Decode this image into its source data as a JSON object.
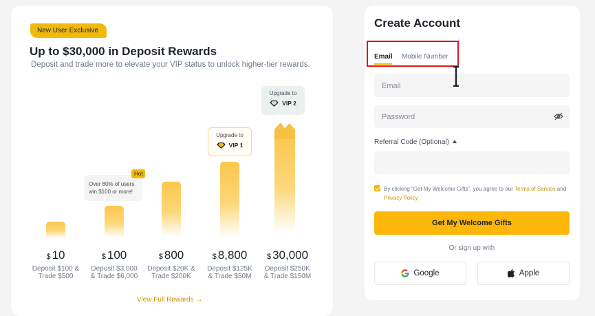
{
  "rewards": {
    "badge": "New User Exclusive",
    "title": "Up to $30,000 in Deposit Rewards",
    "subtitle": "Deposit and trade more to elevate your VIP status to unlock higher-tier rewards.",
    "hot_badge": "Hot",
    "hot_tip_line1": "Over 80% of users",
    "hot_tip_line2": "win $100 or more!",
    "vip1_upgrade": "Upgrade to",
    "vip1_label": "VIP 1",
    "vip2_upgrade": "Upgrade to",
    "vip2_label": "VIP 2",
    "currency": "$",
    "tiers": [
      {
        "amount": "10",
        "line1": "Deposit $100 &",
        "line2": "Trade $500",
        "level": 0.1
      },
      {
        "amount": "100",
        "line1": "Deposit $3,000",
        "line2": "& Trade $6,000",
        "level": 0.22
      },
      {
        "amount": "800",
        "line1": "Deposit $20K &",
        "line2": "Trade $200K",
        "level": 0.42
      },
      {
        "amount": "8,800",
        "line1": "Deposit $125K",
        "line2": "& Trade $50M",
        "level": 0.6
      },
      {
        "amount": "30,000",
        "line1": "Deposit $250K",
        "line2": "& Trade $150M",
        "level": 1.0
      }
    ],
    "view_link": "View Full Rewards →"
  },
  "form": {
    "title": "Create Account",
    "tabs": [
      {
        "label": "Email",
        "active": true
      },
      {
        "label": "Mobile Number",
        "active": false
      }
    ],
    "email_placeholder": "Email",
    "password_placeholder": "Password",
    "referral_label": "Referral Code (Optional)",
    "terms_prefix": "By clicking “Get My Welcome Gifts”, you agree to our ",
    "terms_link1": "Terms of Service",
    "terms_and": " and ",
    "terms_link2": "Privacy Policy",
    "cta_label": "Get My Welcome Gifts",
    "or_text": "Or sign up with",
    "google_label": "Google",
    "apple_label": "Apple"
  },
  "colors": {
    "accent": "#f0b90b",
    "highlight_box": "#e0141e",
    "link": "#c99400"
  }
}
